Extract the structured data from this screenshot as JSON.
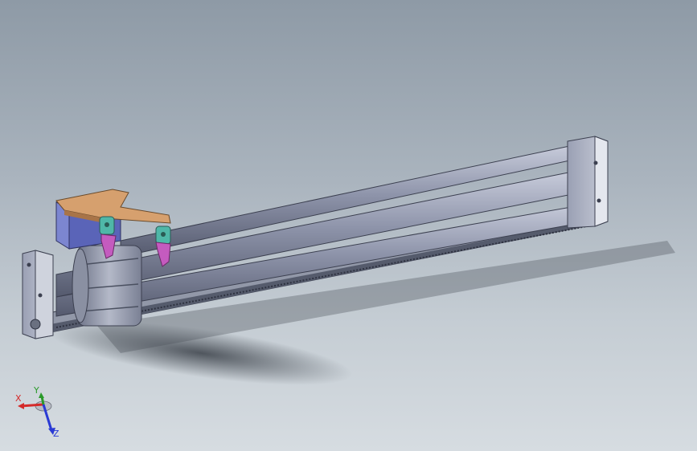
{
  "viewport": {
    "description_free": true,
    "colors": {
      "background_top": "#8e9aa6",
      "background_bottom": "#d6dce1",
      "rod": "#8d93a8",
      "bracket": "#d6a06e",
      "jaw": "#c45bbf",
      "link": "#4fb7a8",
      "plate": "#5a64b8"
    }
  },
  "triad": {
    "x_label": "X",
    "y_label": "Y",
    "z_label": "Z",
    "x_color": "#d42a2a",
    "y_color": "#2a9a2a",
    "z_color": "#2a3ad4"
  }
}
